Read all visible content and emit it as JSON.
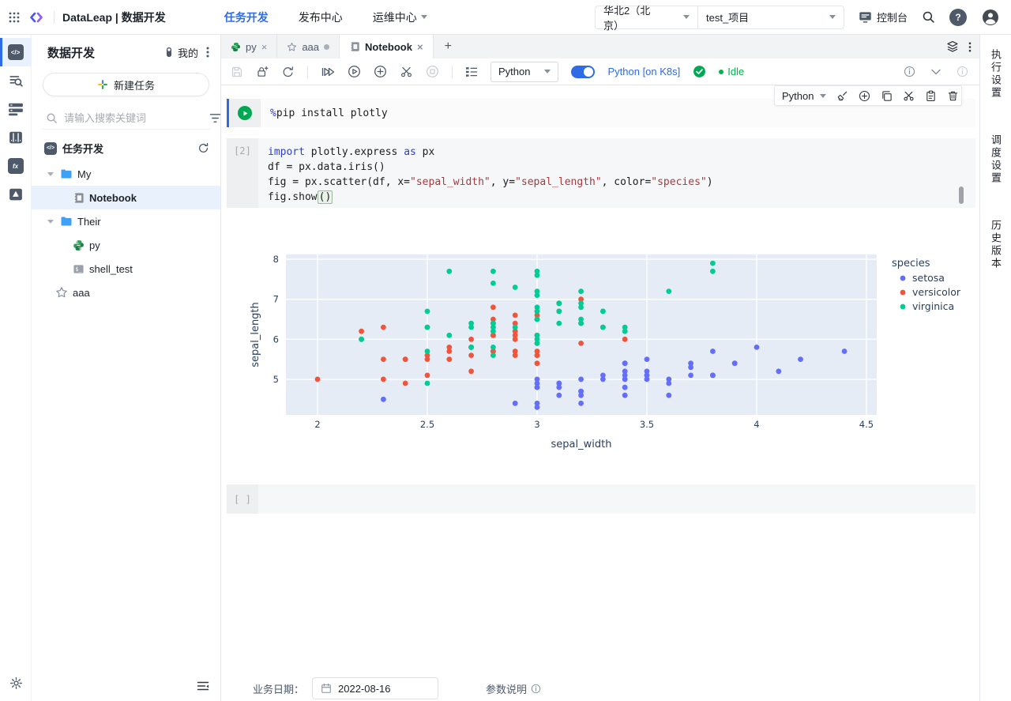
{
  "header": {
    "app_title": "DataLeap | 数据开发",
    "nav": [
      {
        "label": "任务开发",
        "active": true
      },
      {
        "label": "发布中心",
        "active": false
      },
      {
        "label": "运维中心",
        "active": false
      }
    ],
    "region_value": "华北2（北京）",
    "project_value": "test_项目",
    "console_label": "控制台"
  },
  "sidebar": {
    "title": "数据开发",
    "mine_label": "我的",
    "new_task_label": "新建任务",
    "search_placeholder": "请输入搜索关键词",
    "section_title": "任务开发",
    "tree": {
      "folder_my": "My",
      "notebook_item": "Notebook",
      "folder_their": "Their",
      "py_item": "py",
      "shell_item": "shell_test",
      "fav_item": "aaa"
    }
  },
  "tabs": [
    {
      "label": "py"
    },
    {
      "label": "aaa"
    },
    {
      "label": "Notebook"
    }
  ],
  "toolbar": {
    "kernel_value": "Python",
    "runtime_label": "Python [on K8s]",
    "status_label": "Idle"
  },
  "cell_toolbar": {
    "kernel_value": "Python"
  },
  "cells": [
    {
      "gutter": "run",
      "lines": [
        [
          {
            "t": "%",
            "c": "kw"
          },
          {
            "t": "pip install plotly"
          }
        ]
      ]
    },
    {
      "gutter": "[2]",
      "lines": [
        [
          {
            "t": "import",
            "c": "kw"
          },
          {
            "t": " plotly.express "
          },
          {
            "t": "as",
            "c": "kw"
          },
          {
            "t": " px"
          }
        ],
        [
          {
            "t": "df = px.data.iris()"
          }
        ],
        [
          {
            "t": "fig = px.scatter(df, x="
          },
          {
            "t": "\"sepal_width\"",
            "c": "str"
          },
          {
            "t": ", y="
          },
          {
            "t": "\"sepal_length\"",
            "c": "str"
          },
          {
            "t": ", color="
          },
          {
            "t": "\"species\"",
            "c": "str"
          },
          {
            "t": ")"
          }
        ],
        [
          {
            "t": "fig.show"
          },
          {
            "t": "()",
            "c": "match"
          }
        ]
      ]
    },
    {
      "gutter": "[ ]",
      "lines": []
    }
  ],
  "chart_data": {
    "type": "scatter",
    "xlabel": "sepal_width",
    "ylabel": "sepal_length",
    "xlim": [
      1.856,
      4.547
    ],
    "ylim": [
      4.11,
      8.12
    ],
    "xticks": [
      2,
      2.5,
      3,
      3.5,
      4,
      4.5
    ],
    "yticks": [
      5,
      6,
      7,
      8
    ],
    "grid": true,
    "plot_bg": "#E5ECF6",
    "legend_title": "species",
    "legend_position": "right",
    "series": [
      {
        "name": "setosa",
        "color": "#636EFA",
        "points": [
          [
            3.5,
            5.1
          ],
          [
            3.0,
            4.9
          ],
          [
            3.2,
            4.7
          ],
          [
            3.1,
            4.6
          ],
          [
            3.6,
            5.0
          ],
          [
            3.9,
            5.4
          ],
          [
            3.4,
            4.6
          ],
          [
            3.4,
            5.0
          ],
          [
            2.9,
            4.4
          ],
          [
            3.1,
            4.9
          ],
          [
            3.7,
            5.4
          ],
          [
            3.4,
            4.8
          ],
          [
            3.0,
            4.8
          ],
          [
            3.0,
            4.3
          ],
          [
            4.0,
            5.8
          ],
          [
            4.4,
            5.7
          ],
          [
            3.9,
            5.4
          ],
          [
            3.5,
            5.1
          ],
          [
            3.8,
            5.7
          ],
          [
            3.8,
            5.1
          ],
          [
            3.4,
            5.4
          ],
          [
            3.7,
            5.1
          ],
          [
            3.6,
            4.6
          ],
          [
            3.3,
            5.1
          ],
          [
            3.4,
            4.8
          ],
          [
            3.0,
            5.0
          ],
          [
            3.4,
            5.0
          ],
          [
            3.5,
            5.2
          ],
          [
            3.4,
            5.2
          ],
          [
            3.2,
            4.7
          ],
          [
            3.1,
            4.8
          ],
          [
            3.4,
            5.4
          ],
          [
            4.1,
            5.2
          ],
          [
            4.2,
            5.5
          ],
          [
            3.1,
            4.9
          ],
          [
            3.2,
            5.0
          ],
          [
            3.5,
            5.5
          ],
          [
            3.6,
            4.9
          ],
          [
            3.0,
            4.4
          ],
          [
            3.4,
            5.1
          ],
          [
            3.5,
            5.0
          ],
          [
            2.3,
            4.5
          ],
          [
            3.2,
            4.4
          ],
          [
            3.5,
            5.0
          ],
          [
            3.8,
            5.1
          ],
          [
            3.0,
            4.8
          ],
          [
            3.8,
            5.1
          ],
          [
            3.2,
            4.6
          ],
          [
            3.7,
            5.3
          ],
          [
            3.3,
            5.0
          ]
        ]
      },
      {
        "name": "versicolor",
        "color": "#EF553B",
        "points": [
          [
            3.2,
            7.0
          ],
          [
            3.2,
            6.4
          ],
          [
            3.1,
            6.9
          ],
          [
            2.3,
            5.5
          ],
          [
            2.8,
            6.5
          ],
          [
            2.8,
            5.7
          ],
          [
            3.3,
            6.3
          ],
          [
            2.4,
            4.9
          ],
          [
            2.9,
            6.6
          ],
          [
            2.7,
            5.2
          ],
          [
            2.0,
            5.0
          ],
          [
            3.0,
            5.9
          ],
          [
            2.2,
            6.0
          ],
          [
            2.9,
            6.1
          ],
          [
            2.9,
            5.6
          ],
          [
            3.1,
            6.7
          ],
          [
            3.0,
            5.6
          ],
          [
            2.7,
            5.8
          ],
          [
            2.2,
            6.2
          ],
          [
            2.5,
            5.6
          ],
          [
            3.2,
            5.9
          ],
          [
            2.8,
            6.1
          ],
          [
            2.5,
            6.3
          ],
          [
            2.8,
            6.1
          ],
          [
            2.9,
            6.4
          ],
          [
            3.0,
            6.6
          ],
          [
            2.8,
            6.8
          ],
          [
            3.0,
            6.7
          ],
          [
            2.9,
            6.0
          ],
          [
            2.6,
            5.7
          ],
          [
            2.4,
            5.5
          ],
          [
            2.4,
            5.5
          ],
          [
            2.7,
            5.8
          ],
          [
            2.7,
            6.0
          ],
          [
            3.0,
            5.4
          ],
          [
            3.4,
            6.0
          ],
          [
            3.1,
            6.7
          ],
          [
            2.3,
            6.3
          ],
          [
            3.0,
            5.6
          ],
          [
            2.5,
            5.5
          ],
          [
            2.6,
            5.5
          ],
          [
            3.0,
            6.1
          ],
          [
            2.6,
            5.8
          ],
          [
            2.3,
            5.0
          ],
          [
            2.7,
            5.6
          ],
          [
            3.0,
            5.7
          ],
          [
            2.9,
            5.7
          ],
          [
            2.9,
            6.2
          ],
          [
            2.5,
            5.1
          ],
          [
            2.8,
            5.7
          ]
        ]
      },
      {
        "name": "virginica",
        "color": "#00CC96",
        "points": [
          [
            3.3,
            6.3
          ],
          [
            2.7,
            5.8
          ],
          [
            3.0,
            7.1
          ],
          [
            2.9,
            6.3
          ],
          [
            3.0,
            6.5
          ],
          [
            3.0,
            7.6
          ],
          [
            2.5,
            4.9
          ],
          [
            2.9,
            7.3
          ],
          [
            2.5,
            6.7
          ],
          [
            3.6,
            7.2
          ],
          [
            3.2,
            6.5
          ],
          [
            2.7,
            6.4
          ],
          [
            3.0,
            6.8
          ],
          [
            2.5,
            5.7
          ],
          [
            2.8,
            5.8
          ],
          [
            3.2,
            6.4
          ],
          [
            3.0,
            6.5
          ],
          [
            3.8,
            7.7
          ],
          [
            2.6,
            7.7
          ],
          [
            2.2,
            6.0
          ],
          [
            3.2,
            6.9
          ],
          [
            2.8,
            5.6
          ],
          [
            2.8,
            7.7
          ],
          [
            2.7,
            6.3
          ],
          [
            3.3,
            6.7
          ],
          [
            3.2,
            7.2
          ],
          [
            2.8,
            6.2
          ],
          [
            3.0,
            6.1
          ],
          [
            2.8,
            6.4
          ],
          [
            3.0,
            7.2
          ],
          [
            2.8,
            7.4
          ],
          [
            3.8,
            7.9
          ],
          [
            2.8,
            6.4
          ],
          [
            2.8,
            6.3
          ],
          [
            2.6,
            6.1
          ],
          [
            3.0,
            7.7
          ],
          [
            3.4,
            6.3
          ],
          [
            3.1,
            6.4
          ],
          [
            3.0,
            6.0
          ],
          [
            3.1,
            6.9
          ],
          [
            3.1,
            6.7
          ],
          [
            3.1,
            6.9
          ],
          [
            2.7,
            5.8
          ],
          [
            3.2,
            6.8
          ],
          [
            3.3,
            6.7
          ],
          [
            3.0,
            6.7
          ],
          [
            2.5,
            6.3
          ],
          [
            3.0,
            6.5
          ],
          [
            3.4,
            6.2
          ],
          [
            3.0,
            5.9
          ]
        ]
      }
    ]
  },
  "right_panel": {
    "items": [
      "执行设置",
      "调度设置",
      "历史版本"
    ]
  },
  "footer": {
    "date_label": "业务日期：",
    "date_value": "2022-08-16",
    "params_label": "参数说明"
  }
}
